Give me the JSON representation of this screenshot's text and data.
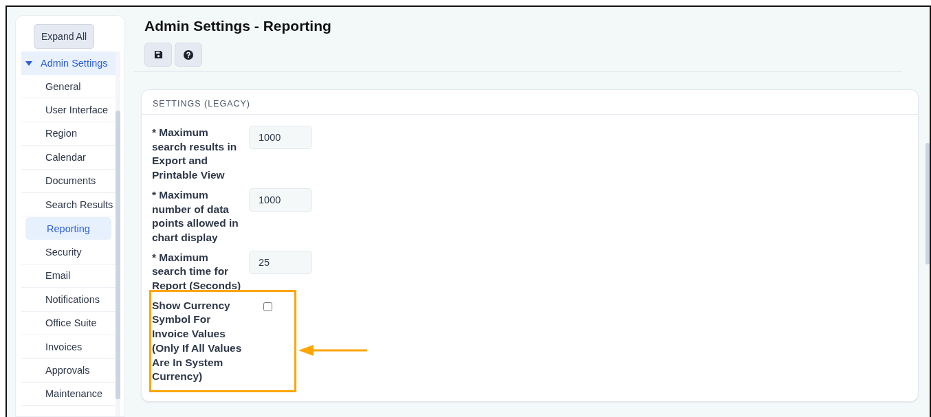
{
  "sidebar": {
    "expand_button": "Expand All",
    "section": {
      "label": "Admin Settings",
      "expanded": true
    },
    "items": [
      {
        "label": "General",
        "selected": false
      },
      {
        "label": "User Interface",
        "selected": false
      },
      {
        "label": "Region",
        "selected": false
      },
      {
        "label": "Calendar",
        "selected": false
      },
      {
        "label": "Documents",
        "selected": false
      },
      {
        "label": "Search Results",
        "selected": false
      },
      {
        "label": "Reporting",
        "selected": true
      },
      {
        "label": "Security",
        "selected": false
      },
      {
        "label": "Email",
        "selected": false
      },
      {
        "label": "Notifications",
        "selected": false
      },
      {
        "label": "Office Suite",
        "selected": false
      },
      {
        "label": "Invoices",
        "selected": false
      },
      {
        "label": "Approvals",
        "selected": false
      },
      {
        "label": "Maintenance",
        "selected": false
      }
    ]
  },
  "page": {
    "title": "Admin Settings - Reporting"
  },
  "panel": {
    "title": "SETTINGS (LEGACY)",
    "fields": [
      {
        "kind": "input",
        "label": "* Maximum search results in Export and Printable View",
        "value": "1000"
      },
      {
        "kind": "input",
        "label": "* Maximum number of data points allowed in chart display",
        "value": "1000"
      },
      {
        "kind": "input",
        "label": "* Maximum search time for Report (Seconds)",
        "value": "25"
      },
      {
        "kind": "checkbox",
        "label": "Show Currency Symbol For Invoice Values (Only If All Values Are In System Currency)",
        "checked": false,
        "highlighted": true
      }
    ]
  }
}
